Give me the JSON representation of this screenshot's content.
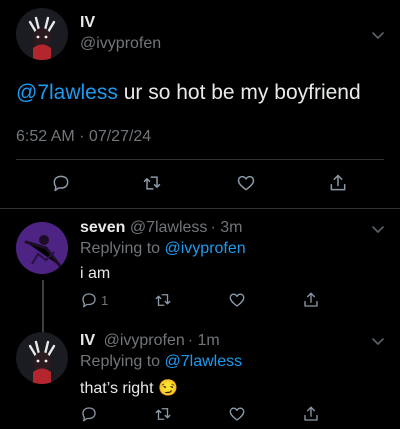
{
  "main_tweet": {
    "display_name": "IV",
    "handle": "@ivyprofen",
    "mention": "@7lawless",
    "text": " ur so hot be my boyfriend",
    "timestamp": "6:52 AM · 07/27/24"
  },
  "replies": [
    {
      "display_name": "seven",
      "handle": "@7lawless",
      "time": "· 3m",
      "replying_label": "Replying to",
      "replying_to": "@ivyprofen",
      "text": "i am",
      "reply_count": "1"
    },
    {
      "display_name": "IV",
      "handle": "@ivyprofen",
      "time": "· 1m",
      "replying_label": "Replying to",
      "replying_to": "@7lawless",
      "text": "that’s right 😏",
      "reply_count": ""
    }
  ],
  "colors": {
    "background": "#000000",
    "text": "#e7e9ea",
    "muted": "#71767b",
    "accent": "#1d9bf0",
    "icon": "#8b98a5"
  },
  "icons": [
    "chevron-down-icon",
    "reply-icon",
    "retweet-icon",
    "like-icon",
    "share-icon"
  ]
}
